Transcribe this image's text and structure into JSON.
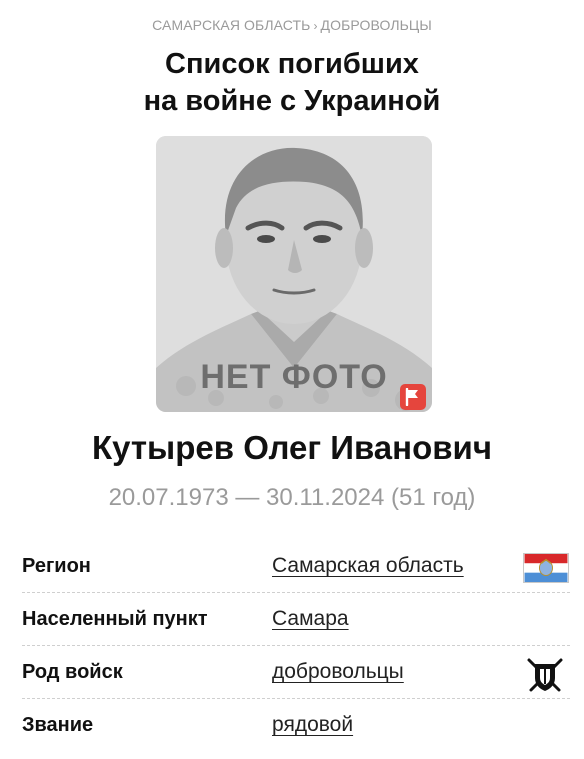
{
  "breadcrumb": {
    "region": "САМАРСКАЯ ОБЛАСТЬ",
    "separator": "›",
    "category": "ДОБРОВОЛЬЦЫ"
  },
  "page": {
    "title_line1": "Список погибших",
    "title_line2": "на войне с Украиной"
  },
  "photo": {
    "placeholder_text": "НЕТ ФОТО",
    "report_icon": "flag-icon"
  },
  "person": {
    "name": "Кутырев Олег Иванович",
    "dates": "20.07.1973 — 30.11.2024 (51 год)"
  },
  "details": [
    {
      "label": "Регион",
      "value": "Самарская область",
      "icon": "region-flag-icon"
    },
    {
      "label": "Населенный пункт",
      "value": "Самара"
    },
    {
      "label": "Род войск",
      "value": "добровольцы",
      "icon": "volunteers-emblem-icon"
    },
    {
      "label": "Звание",
      "value": "рядовой"
    }
  ],
  "colors": {
    "accent_red": "#e5453d",
    "muted_text": "#9a9a9a",
    "flag_red": "#d8282a",
    "flag_blue": "#4d8fd6"
  }
}
